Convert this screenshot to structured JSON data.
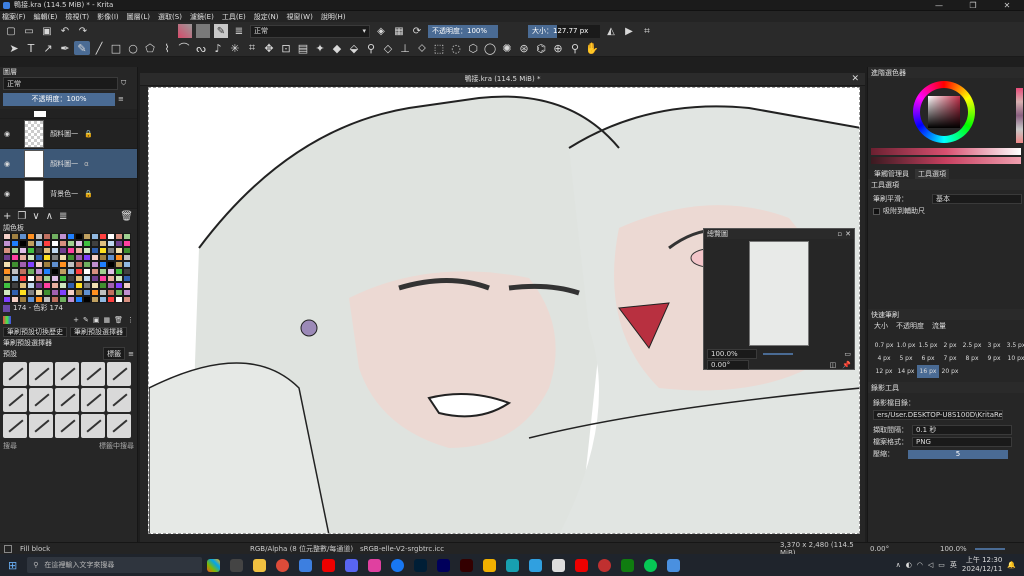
{
  "window": {
    "title": "鴨接.kra (114.5 MiB) * - Krita",
    "controls": [
      "—",
      "❐",
      "✕"
    ]
  },
  "menu": [
    "檔案(F)",
    "編輯(E)",
    "檢視(T)",
    "影像(I)",
    "圖層(L)",
    "選取(S)",
    "濾鏡(E)",
    "工具(E)",
    "設定(N)",
    "視窗(W)",
    "說明(H)"
  ],
  "toolbar": {
    "blend_mode": "正常",
    "opacity_label": "不透明度：100%",
    "size_label": "大小：127.77 px"
  },
  "document_tab": "鴨接.kra (114.5 MiB) *",
  "layers_panel": {
    "title": "圖層",
    "blend_mode": "正常",
    "opacity": "不透明度：100%",
    "layers": [
      {
        "name": "",
        "type": "group"
      },
      {
        "name": "顏料圖一",
        "type": "paint"
      },
      {
        "name": "顏料圖一",
        "type": "paint",
        "selected": true
      },
      {
        "name": "背景色一",
        "type": "background"
      }
    ]
  },
  "palette_panel": {
    "title": "調色板",
    "footer": "174 - 色彩 174"
  },
  "brush_panel": {
    "tabs": [
      "筆刷預設切換歷史",
      "筆刷預設選擇器"
    ],
    "title": "筆刷預設選擇器",
    "category": "預設",
    "tag": "標籤",
    "footer_left": "搜尋",
    "footer_right": "標籤中搜尋"
  },
  "overview": {
    "title": "總覽圖",
    "zoom": "100.0%",
    "rotation": "0.00°"
  },
  "right_panel": {
    "color_title": "進階選色器",
    "tabs": [
      "筆觸管理員",
      "工具選項"
    ],
    "tool_options_title": "工具選項",
    "smoothing_label": "筆刷平滑：",
    "smoothing_value": "基本",
    "assistant_label": "吸附到輔助尺",
    "presets_title": "快速筆刷",
    "presets_tabs": [
      "大小",
      "不透明度",
      "流量"
    ],
    "size_dots": [
      "0.7 px",
      "1.0 px",
      "1.5 px",
      "2 px",
      "2.5 px",
      "3 px",
      "3.5 px",
      "4 px",
      "5 px",
      "6 px",
      "7 px",
      "8 px",
      "9 px",
      "10 px",
      "12 px",
      "14 px",
      "16 px",
      "20 px"
    ],
    "recorder_title": "錄影工具",
    "recorder_dir_label": "錄影檔目錄：",
    "recorder_dir_value": "ers/User.DESKTOP-U8S100D\\KritaRecorder",
    "capture_label": "擷取間隔：",
    "capture_value": "0.1 秒",
    "format_label": "檔案格式：",
    "format_value": "PNG",
    "quality_label": "壓縮：",
    "quality_value": "5"
  },
  "statusbar": {
    "tool": "Fill block",
    "colorspace": "RGB/Alpha (8 位元整數/每通道)",
    "profile": "sRGB-elle-V2-srgbtrc.icc",
    "dimensions": "3,370 x 2,480 (114.5 MiB)",
    "rotation": "0.00°",
    "zoom": "100.0%"
  },
  "taskbar": {
    "search_placeholder": "在這裡輸入文字來搜尋",
    "time": "上午 12:30",
    "date": "2024/12/11",
    "lang": "英"
  }
}
